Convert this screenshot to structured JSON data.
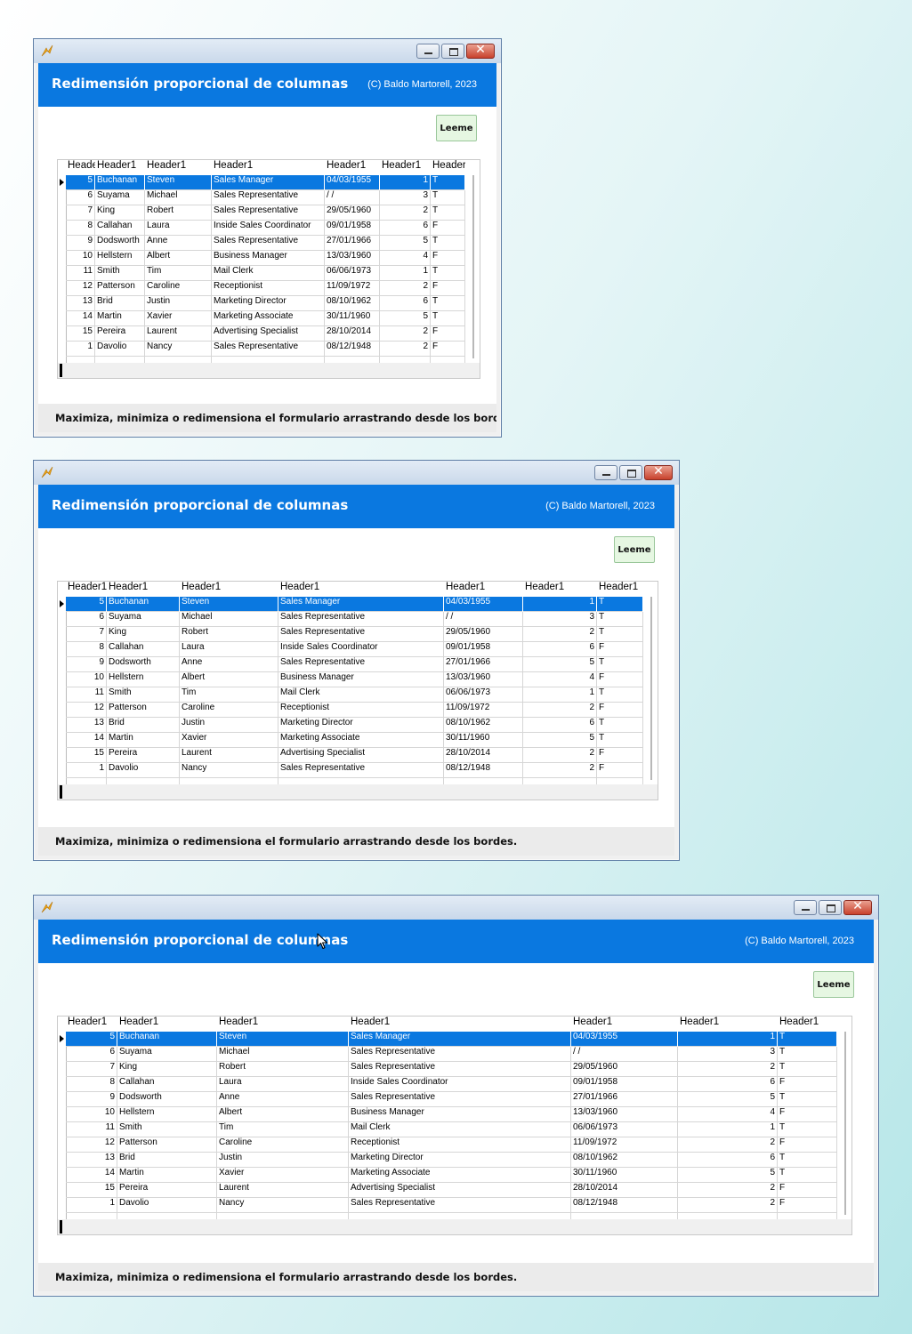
{
  "form": {
    "title": "Redimensión proporcional de columnas",
    "copyright": "(C) Baldo Martorell, 2023",
    "readme_button": "Leeme",
    "footer": "Maximiza, minimiza o redimensiona el formulario arrastrando desde los bordes.",
    "close_glyph": "✕"
  },
  "grid": {
    "header_label": "Header1",
    "selected_row": 0,
    "rows": [
      [
        "5",
        "Buchanan",
        "Steven",
        "Sales Manager",
        "04/03/1955",
        "1",
        "T"
      ],
      [
        "6",
        "Suyama",
        "Michael",
        "Sales Representative",
        "/ /",
        "3",
        "T"
      ],
      [
        "7",
        "King",
        "Robert",
        "Sales Representative",
        "29/05/1960",
        "2",
        "T"
      ],
      [
        "8",
        "Callahan",
        "Laura",
        "Inside Sales Coordinator",
        "09/01/1958",
        "6",
        "F"
      ],
      [
        "9",
        "Dodsworth",
        "Anne",
        "Sales Representative",
        "27/01/1966",
        "5",
        "T"
      ],
      [
        "10",
        "Hellstern",
        "Albert",
        "Business Manager",
        "13/03/1960",
        "4",
        "F"
      ],
      [
        "11",
        "Smith",
        "Tim",
        "Mail Clerk",
        "06/06/1973",
        "1",
        "T"
      ],
      [
        "12",
        "Patterson",
        "Caroline",
        "Receptionist",
        "11/09/1972",
        "2",
        "F"
      ],
      [
        "13",
        "Brid",
        "Justin",
        "Marketing Director",
        "08/10/1962",
        "6",
        "T"
      ],
      [
        "14",
        "Martin",
        "Xavier",
        "Marketing Associate",
        "30/11/1960",
        "5",
        "T"
      ],
      [
        "15",
        "Pereira",
        "Laurent",
        "Advertising Specialist",
        "28/10/2014",
        "2",
        "F"
      ],
      [
        "1",
        "Davolio",
        "Nancy",
        "Sales Representative",
        "08/12/1948",
        "2",
        "F"
      ]
    ]
  },
  "colors": {
    "header_blue": "#0a78e0",
    "selection": "#0a78e0",
    "readme_bg": "#e6f7e2",
    "footer_bg": "#ebebeb"
  },
  "icons": {
    "app": "app-icon",
    "minimize": "minimize-icon",
    "maximize": "maximize-icon",
    "close": "close-icon",
    "row_pointer": "row-pointer-icon",
    "cursor": "mouse-pointer-icon"
  }
}
